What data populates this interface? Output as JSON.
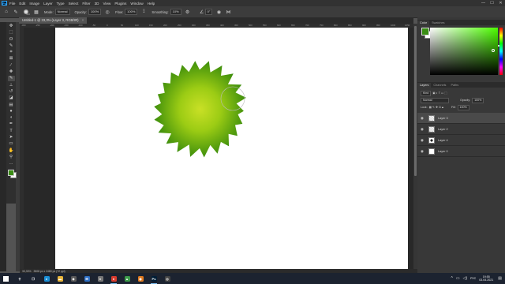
{
  "app": {
    "logo": "Ps",
    "menu": [
      "File",
      "Edit",
      "Image",
      "Layer",
      "Type",
      "Select",
      "Filter",
      "3D",
      "View",
      "Plugins",
      "Window",
      "Help"
    ],
    "window_controls": [
      "—",
      "☐",
      "✕"
    ]
  },
  "options_bar": {
    "brush_size": "500",
    "mode_label": "Mode:",
    "mode_value": "Normal",
    "opacity_label": "Opacity:",
    "opacity_value": "100%",
    "flow_label": "Flow:",
    "flow_value": "100%",
    "smoothing_label": "Smoothing:",
    "smoothing_value": "10%",
    "angle_value": "0°"
  },
  "document": {
    "tab_title": "Untitled-1 @ 33,3% (Layer 3, RGB/8#)",
    "tab_close": "×",
    "status_zoom": "33,33%",
    "status_info": "3508 px x 2480 px (72 ppi)"
  },
  "ruler_ticks": [
    "-300",
    "-250",
    "-200",
    "-150",
    "-100",
    "-50",
    "0",
    "50",
    "100",
    "150",
    "200",
    "250",
    "300",
    "350",
    "400",
    "450",
    "500",
    "550",
    "600",
    "650",
    "700",
    "750",
    "800",
    "850",
    "900",
    "950",
    "1000",
    "1050"
  ],
  "tools": [
    {
      "name": "move-tool",
      "glyph": "✥"
    },
    {
      "name": "marquee-tool",
      "glyph": "⬚"
    },
    {
      "name": "lasso-tool",
      "glyph": "ʘ"
    },
    {
      "name": "quick-select-tool",
      "glyph": "✎"
    },
    {
      "name": "crop-tool",
      "glyph": "⌗"
    },
    {
      "name": "frame-tool",
      "glyph": "⊠"
    },
    {
      "name": "eyedropper-tool",
      "glyph": "⁄"
    },
    {
      "name": "healing-tool",
      "glyph": "✚"
    },
    {
      "name": "brush-tool",
      "glyph": "✎"
    },
    {
      "name": "stamp-tool",
      "glyph": "⊥"
    },
    {
      "name": "history-brush-tool",
      "glyph": "↺"
    },
    {
      "name": "eraser-tool",
      "glyph": "◪"
    },
    {
      "name": "gradient-tool",
      "glyph": "▤"
    },
    {
      "name": "blur-tool",
      "glyph": "●"
    },
    {
      "name": "dodge-tool",
      "glyph": "◖"
    },
    {
      "name": "pen-tool",
      "glyph": "✒"
    },
    {
      "name": "type-tool",
      "glyph": "T"
    },
    {
      "name": "path-select-tool",
      "glyph": "➤"
    },
    {
      "name": "shape-tool",
      "glyph": "▭"
    },
    {
      "name": "hand-tool",
      "glyph": "✋"
    },
    {
      "name": "zoom-tool",
      "glyph": "⚲"
    },
    {
      "name": "more-tools",
      "glyph": "…"
    }
  ],
  "color_panel": {
    "tabs": [
      "Color",
      "Swatches"
    ],
    "fg_color": "#3a8d14",
    "bg_color": "#ffffff"
  },
  "layers_panel": {
    "tabs": [
      "Layers",
      "Channels",
      "Paths"
    ],
    "filter_label": "Kind",
    "blend_mode": "Normal",
    "opacity_label": "Opacity:",
    "opacity_value": "100%",
    "lock_label": "Lock:",
    "fill_label": "Fill:",
    "fill_value": "100%",
    "layers": [
      {
        "name": "Layer 3",
        "thumb": "checker",
        "selected": true
      },
      {
        "name": "Layer 2",
        "thumb": "checker",
        "selected": false
      },
      {
        "name": "Layer 4",
        "thumb": "dark",
        "selected": false
      },
      {
        "name": "Layer 0",
        "thumb": "white",
        "selected": false
      }
    ]
  },
  "taskbar": {
    "apps": [
      {
        "name": "search",
        "glyph": "⚲",
        "color": "#1c2330"
      },
      {
        "name": "task-view",
        "glyph": "❐",
        "color": "#1c2330"
      },
      {
        "name": "edge",
        "glyph": "e",
        "color": "#1b8fd6"
      },
      {
        "name": "explorer",
        "glyph": "▬",
        "color": "#e8b53b"
      },
      {
        "name": "store",
        "glyph": "◆",
        "color": "#5a5a5a"
      },
      {
        "name": "mail",
        "glyph": "✉",
        "color": "#2d6fc4"
      },
      {
        "name": "app-gray",
        "glyph": "●",
        "color": "#777"
      },
      {
        "name": "chrome",
        "glyph": "●",
        "color": "#d93c2e"
      },
      {
        "name": "app-green",
        "glyph": "▲",
        "color": "#3c9a4a"
      },
      {
        "name": "app-orange",
        "glyph": "◉",
        "color": "#e07a1f"
      },
      {
        "name": "photoshop",
        "glyph": "Ps",
        "color": "#001e36"
      },
      {
        "name": "app-circle",
        "glyph": "◎",
        "color": "#444"
      }
    ],
    "language": "РУС",
    "time": "19:55",
    "date": "03.04.2021"
  }
}
